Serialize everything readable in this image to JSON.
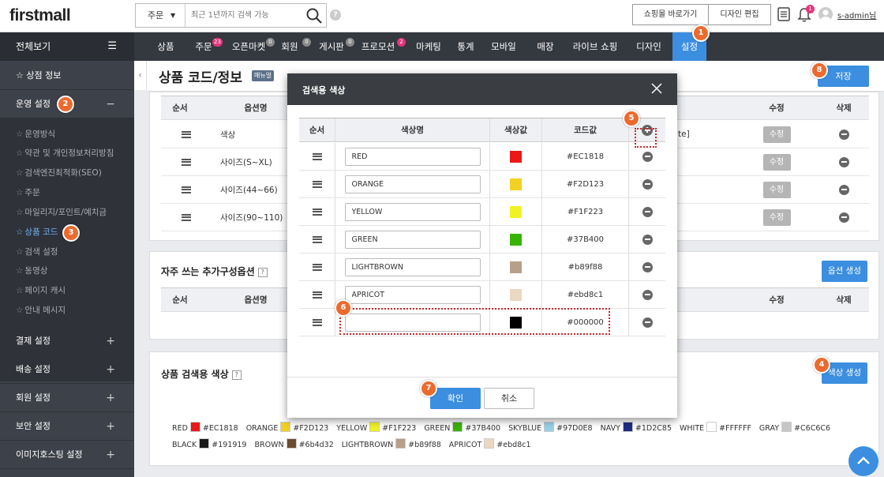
{
  "header": {
    "logo": "firstmall",
    "search_scope": "주문",
    "search_placeholder": "최근 1년까지 검색 가능",
    "help": "?",
    "btn_shop": "쇼핑몰 바로가기",
    "btn_design": "디자인 편집",
    "notification_count": "1",
    "user": "s-admin님"
  },
  "nav": {
    "all_label": "전체보기",
    "items": [
      {
        "label": "상품",
        "badge": ""
      },
      {
        "label": "주문",
        "badge": "23"
      },
      {
        "label": "오픈마켓",
        "badge": "0"
      },
      {
        "label": "회원",
        "badge": "0"
      },
      {
        "label": "게시판",
        "badge": "0"
      },
      {
        "label": "프로모션",
        "badge": "2"
      },
      {
        "label": "마케팅",
        "badge": ""
      },
      {
        "label": "통계",
        "badge": ""
      },
      {
        "label": "모바일",
        "badge": ""
      },
      {
        "label": "매장",
        "badge": ""
      },
      {
        "label": "라이브 쇼핑",
        "badge": ""
      },
      {
        "label": "디자인",
        "badge": ""
      },
      {
        "label": "설정",
        "badge": ""
      }
    ]
  },
  "sidebar": {
    "top": "☆ 상점 정보",
    "section_ops": "운영 설정",
    "sub_items": [
      "운영방식",
      "약관 및 개인정보처리방침",
      "검색엔진최적화(SEO)",
      "주문",
      "마일리지/포인트/예치금",
      "상품 코드",
      "검색 설정",
      "동영상",
      "페이지 캐시",
      "안내 메시지"
    ],
    "sections": [
      "결제 설정",
      "배송 설정",
      "회원 설정",
      "보안 설정",
      "이미지호스팅 설정"
    ]
  },
  "markers": [
    "1",
    "2",
    "3",
    "4",
    "5",
    "6",
    "7",
    "8"
  ],
  "page": {
    "title": "상품 코드/정보",
    "manual": "매뉴얼",
    "save": "저장"
  },
  "option_table": {
    "headers": [
      "순서",
      "옵션명",
      "수정",
      "삭제"
    ],
    "rows": [
      "색상",
      "사이즈(S~XL)",
      "사이즈(44~66)",
      "사이즈(90~110)"
    ],
    "edit_label": "수정",
    "row_extra": "te]"
  },
  "extra_section": {
    "title": "자주 쓰는 추가구성옵션",
    "button": "옵션 생성",
    "headers": [
      "순서",
      "옵션명",
      "수정",
      "삭제"
    ]
  },
  "color_section": {
    "title": "상품 검색용 색상",
    "button": "색상 생성",
    "legend_line1": [
      {
        "name": "RED",
        "code": "#EC1818",
        "color": "#EC1818"
      },
      {
        "name": "ORANGE",
        "code": "#F2D123",
        "color": "#F2D123"
      },
      {
        "name": "YELLOW",
        "code": "#F1F223",
        "color": "#F1F223"
      },
      {
        "name": "GREEN",
        "code": "#37B400",
        "color": "#37B400"
      },
      {
        "name": "SKYBLUE",
        "code": "#97D0E8",
        "color": "#97D0E8"
      },
      {
        "name": "NAVY",
        "code": "#1D2C85",
        "color": "#1D2C85"
      },
      {
        "name": "WHITE",
        "code": "#FFFFFF",
        "color": "#FFFFFF"
      },
      {
        "name": "GRAY",
        "code": "#C6C6C6",
        "color": "#C6C6C6"
      }
    ],
    "legend_line2": [
      {
        "name": "BLACK",
        "code": "#191919",
        "color": "#191919"
      },
      {
        "name": "BROWN",
        "code": "#6b4d32",
        "color": "#6b4d32"
      },
      {
        "name": "LIGHTBROWN",
        "code": "#b89f88",
        "color": "#b89f88"
      },
      {
        "name": "APRICOT",
        "code": "#ebd8c1",
        "color": "#ebd8c1"
      }
    ]
  },
  "modal": {
    "title": "검색용 색상",
    "headers": [
      "순서",
      "색상명",
      "색상값",
      "코드값"
    ],
    "rows": [
      {
        "name": "RED",
        "code": "#EC1818",
        "color": "#EC1818"
      },
      {
        "name": "ORANGE",
        "code": "#F2D123",
        "color": "#F2D123"
      },
      {
        "name": "YELLOW",
        "code": "#F1F223",
        "color": "#F1F223"
      },
      {
        "name": "GREEN",
        "code": "#37B400",
        "color": "#37B400"
      },
      {
        "name": "LIGHTBROWN",
        "code": "#b89f88",
        "color": "#b89f88"
      },
      {
        "name": "APRICOT",
        "code": "#ebd8c1",
        "color": "#ebd8c1"
      },
      {
        "name": "",
        "code": "#000000",
        "color": "#000000"
      }
    ],
    "confirm": "확인",
    "cancel": "취소"
  },
  "colors": {
    "accent": "#3b8ee0",
    "marker": "#ed6a2e",
    "nav_bg": "#34383f",
    "highlight": "#c9252c"
  }
}
